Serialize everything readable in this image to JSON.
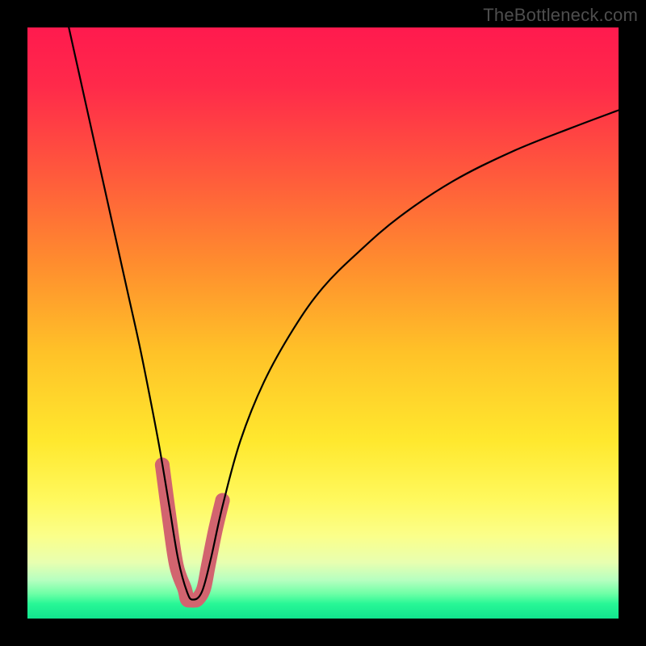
{
  "watermark": "TheBottleneck.com",
  "colors": {
    "background": "#000000",
    "gradient_stops": [
      {
        "offset": 0.0,
        "color": "#ff1a4e"
      },
      {
        "offset": 0.1,
        "color": "#ff2a4a"
      },
      {
        "offset": 0.25,
        "color": "#ff5a3c"
      },
      {
        "offset": 0.4,
        "color": "#ff8d2e"
      },
      {
        "offset": 0.55,
        "color": "#ffc228"
      },
      {
        "offset": 0.7,
        "color": "#ffe82e"
      },
      {
        "offset": 0.8,
        "color": "#fff95e"
      },
      {
        "offset": 0.86,
        "color": "#fbff8a"
      },
      {
        "offset": 0.905,
        "color": "#e8ffb0"
      },
      {
        "offset": 0.935,
        "color": "#b6ffc0"
      },
      {
        "offset": 0.958,
        "color": "#6effa6"
      },
      {
        "offset": 0.975,
        "color": "#28f796"
      },
      {
        "offset": 1.0,
        "color": "#11e58e"
      }
    ],
    "curve": "#000000",
    "marker": "#d2646f"
  },
  "chart_data": {
    "type": "line",
    "title": "",
    "xlabel": "",
    "ylabel": "",
    "xlim": [
      0,
      100
    ],
    "ylim": [
      0,
      100
    ],
    "series": [
      {
        "name": "curve",
        "x": [
          7,
          9,
          11,
          13,
          15,
          17,
          19,
          21,
          22.5,
          24,
          25.5,
          27,
          28,
          29.5,
          31,
          33,
          36,
          40,
          45,
          50,
          56,
          63,
          72,
          82,
          92,
          100
        ],
        "y": [
          100,
          91,
          82,
          73,
          64,
          55,
          46,
          36,
          28,
          19,
          10,
          4.5,
          3.2,
          4.5,
          10,
          19,
          30,
          40,
          49,
          56,
          62,
          68,
          74,
          79,
          83,
          86
        ]
      }
    ],
    "markers": {
      "name": "bottom-highlight",
      "x": [
        22.8,
        24.0,
        25.2,
        26.6,
        27.0,
        27.6,
        28.2,
        28.8,
        29.8,
        30.6,
        31.8,
        33.0
      ],
      "y": [
        26.0,
        17.0,
        9.0,
        5.0,
        3.3,
        3.1,
        3.1,
        3.3,
        5.0,
        9.0,
        15.0,
        20.0
      ]
    }
  }
}
